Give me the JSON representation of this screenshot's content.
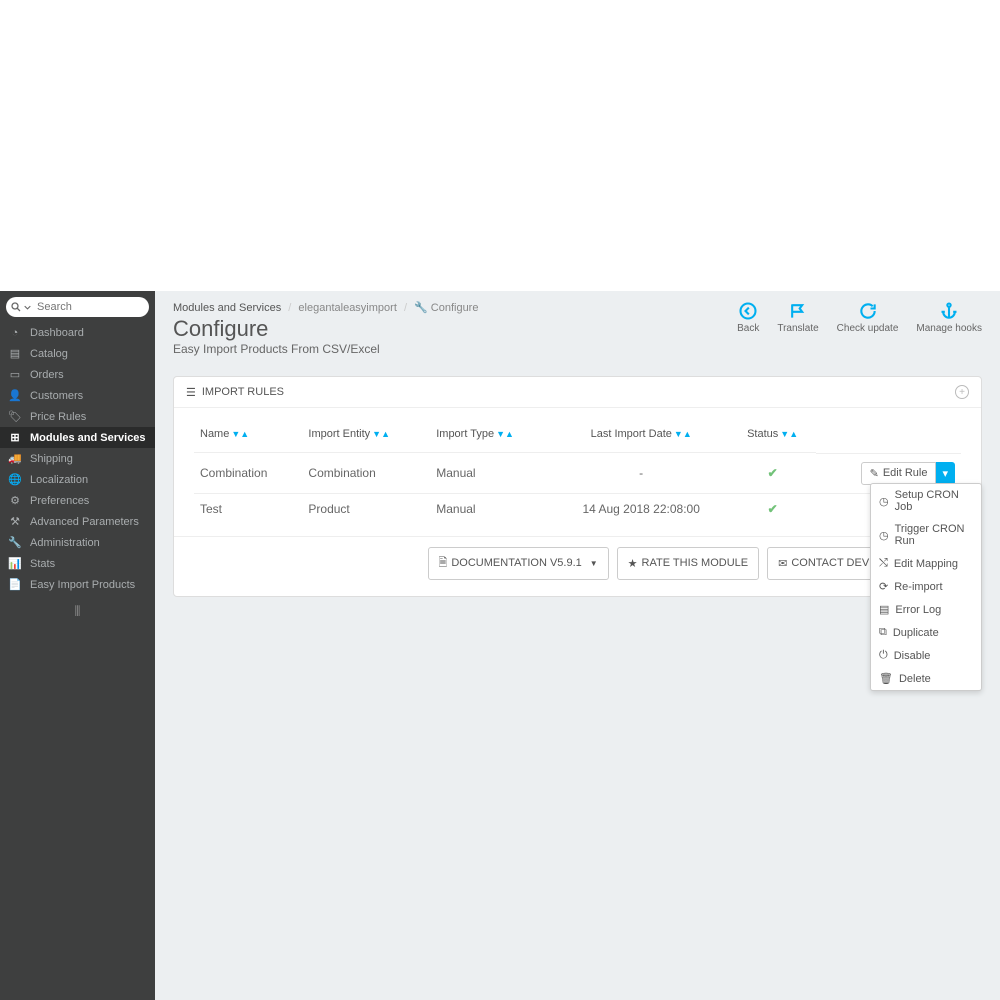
{
  "search": {
    "placeholder": "Search"
  },
  "sidebar": {
    "items": [
      {
        "label": "Dashboard"
      },
      {
        "label": "Catalog"
      },
      {
        "label": "Orders"
      },
      {
        "label": "Customers"
      },
      {
        "label": "Price Rules"
      },
      {
        "label": "Modules and Services"
      },
      {
        "label": "Shipping"
      },
      {
        "label": "Localization"
      },
      {
        "label": "Preferences"
      },
      {
        "label": "Advanced Parameters"
      },
      {
        "label": "Administration"
      },
      {
        "label": "Stats"
      },
      {
        "label": "Easy Import Products"
      }
    ]
  },
  "breadcrumb": {
    "a": "Modules and Services",
    "b": "elegantaleasyimport",
    "c": "Configure"
  },
  "page": {
    "title": "Configure",
    "subtitle": "Easy Import Products From CSV/Excel"
  },
  "toolbar": {
    "back": "Back",
    "translate": "Translate",
    "check": "Check update",
    "hooks": "Manage hooks"
  },
  "panel": {
    "title": "IMPORT RULES",
    "cols": {
      "name": "Name",
      "entity": "Import Entity",
      "type": "Import Type",
      "date": "Last Import Date",
      "status": "Status"
    },
    "rows": [
      {
        "name": "Combination",
        "entity": "Combination",
        "type": "Manual",
        "date": "-",
        "status": "ok"
      },
      {
        "name": "Test",
        "entity": "Product",
        "type": "Manual",
        "date": "14 Aug 2018 22:08:00",
        "status": "ok"
      }
    ],
    "edit": "Edit Rule"
  },
  "buttons": {
    "doc": "DOCUMENTATION V5.9.1",
    "rate": "RATE THIS MODULE",
    "contact": "CONTACT DEVELOPER",
    "create": ""
  },
  "dropdown": {
    "setup": "Setup CRON Job",
    "trigger": "Trigger CRON Run",
    "mapping": "Edit Mapping",
    "reimport": "Re-import",
    "errorlog": "Error Log",
    "duplicate": "Duplicate",
    "disable": "Disable",
    "delete": "Delete"
  }
}
